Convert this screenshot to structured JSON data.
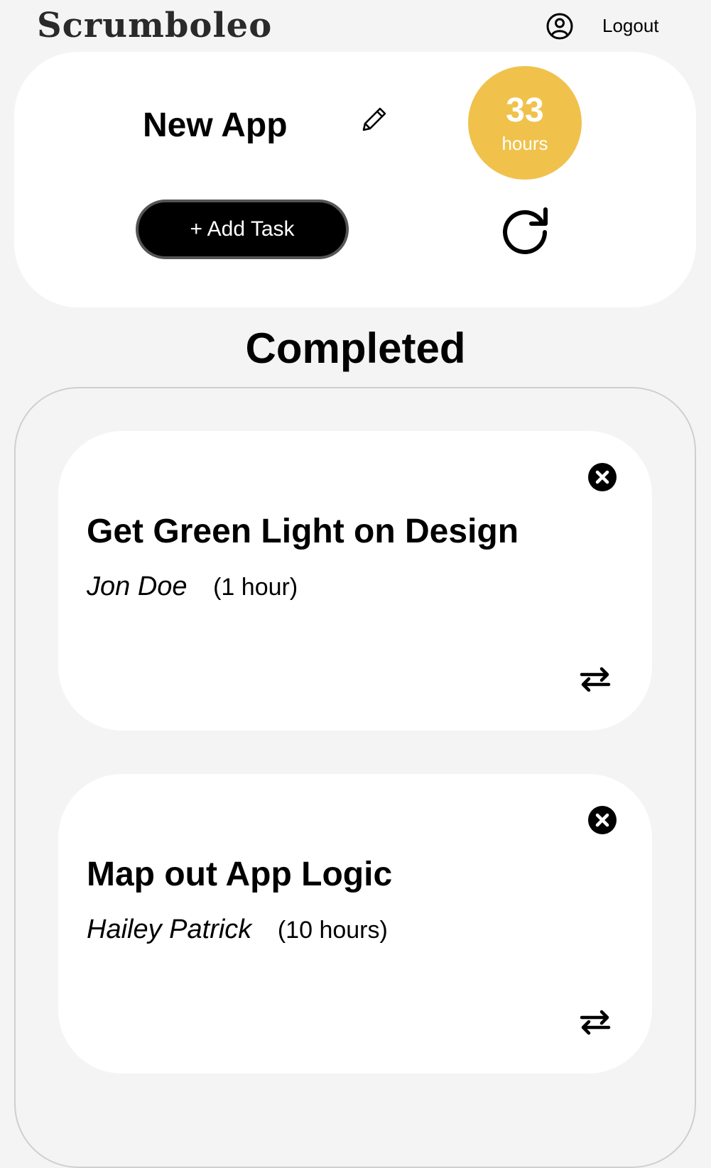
{
  "header": {
    "logo": "Scrumboleo",
    "logout_label": "Logout"
  },
  "project": {
    "name": "New App",
    "hours_value": "33",
    "hours_unit": "hours",
    "add_task_label": "+ Add Task"
  },
  "section": {
    "title": "Completed"
  },
  "tasks": [
    {
      "title": "Get Green Light on Design",
      "assignee": "Jon Doe",
      "duration": "(1 hour)"
    },
    {
      "title": "Map out App Logic",
      "assignee": "Hailey Patrick",
      "duration": "(10 hours)"
    }
  ],
  "colors": {
    "hours_badge": "#f0c24c",
    "page_background": "#f4f4f4",
    "card_background": "#ffffff"
  },
  "icons": [
    "user-circle-icon",
    "pencil-icon",
    "refresh-icon",
    "close-circle-icon",
    "swap-arrows-icon"
  ]
}
